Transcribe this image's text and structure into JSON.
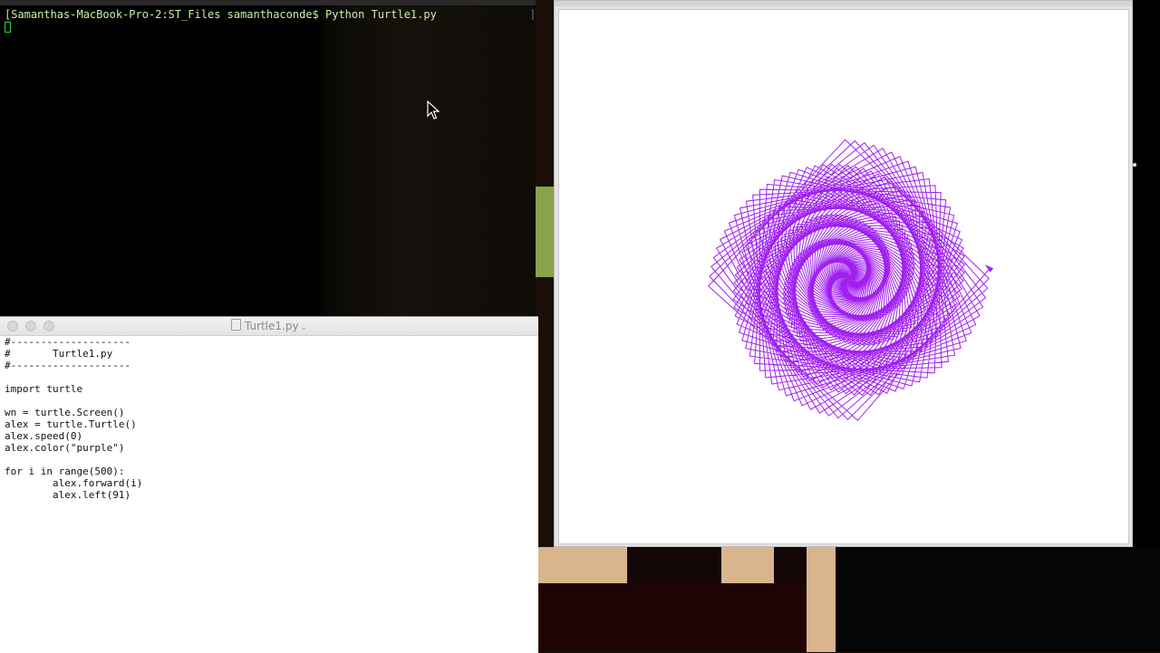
{
  "terminal": {
    "prompt_line": "[Samanthas-MacBook-Pro-2:ST_Files samanthaconde$ Python Turtle1.py"
  },
  "editor": {
    "title": "Turtle1.py",
    "lines": [
      "#--------------------",
      "#       Turtle1.py",
      "#--------------------",
      "",
      "import turtle",
      "",
      "wn = turtle.Screen()",
      "alex = turtle.Turtle()",
      "alex.speed(0)",
      "alex.color(\"purple\")",
      "",
      "for i in range(500):",
      "        alex.forward(i)",
      "        alex.left(91)"
    ]
  },
  "turtle": {
    "pen_color": "#a020f0",
    "steps": 500,
    "turn_degrees": 91
  },
  "colors": {
    "terminal_text": "#c6f3a6",
    "terminal_cursor": "#2fd52f"
  }
}
